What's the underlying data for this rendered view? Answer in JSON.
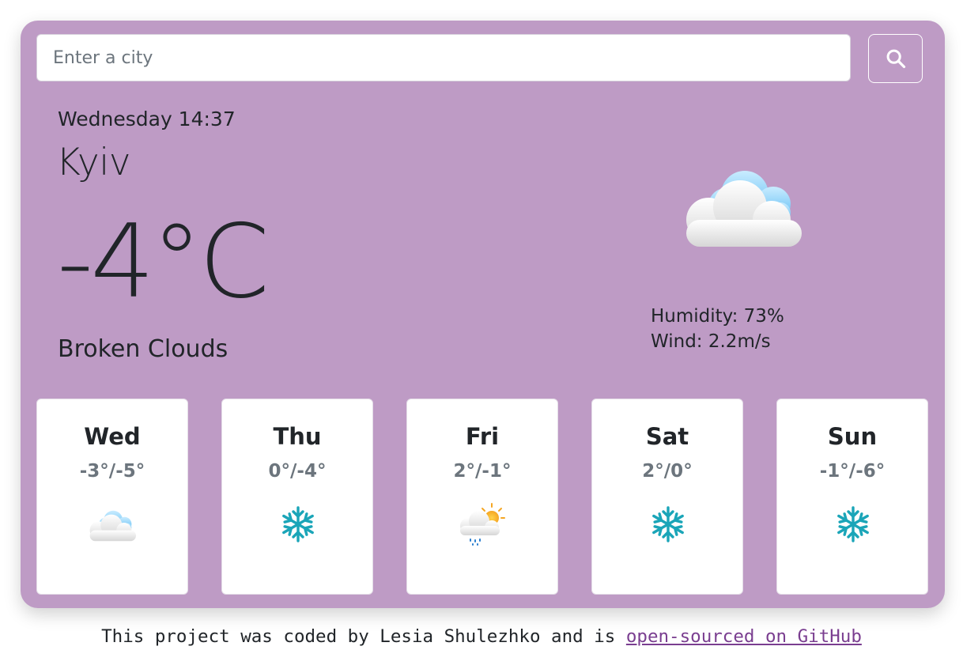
{
  "search": {
    "placeholder": "Enter a city",
    "button_icon": "search-icon"
  },
  "current": {
    "datetime": "Wednesday 14:37",
    "city": "Kyiv",
    "temperature": "-4°C",
    "description": "Broken Clouds",
    "icon": "broken-clouds-icon",
    "humidity": "Humidity: 73%",
    "wind": "Wind: 2.2m/s"
  },
  "forecast": [
    {
      "day": "Wed",
      "temps": "-3°/-5°",
      "icon": "broken-clouds-icon"
    },
    {
      "day": "Thu",
      "temps": "0°/-4°",
      "icon": "snowflake-icon"
    },
    {
      "day": "Fri",
      "temps": "2°/-1°",
      "icon": "sun-cloud-rain-icon"
    },
    {
      "day": "Sat",
      "temps": "2°/0°",
      "icon": "snowflake-icon"
    },
    {
      "day": "Sun",
      "temps": "-1°/-6°",
      "icon": "snowflake-icon"
    }
  ],
  "footer": {
    "text": "This project was coded by Lesia Shulezhko and is ",
    "link_text": "open-sourced on GitHub"
  },
  "colors": {
    "card_background": "#be9bc5",
    "snowflake": "#1aa5b8",
    "link": "#7a3e90"
  }
}
